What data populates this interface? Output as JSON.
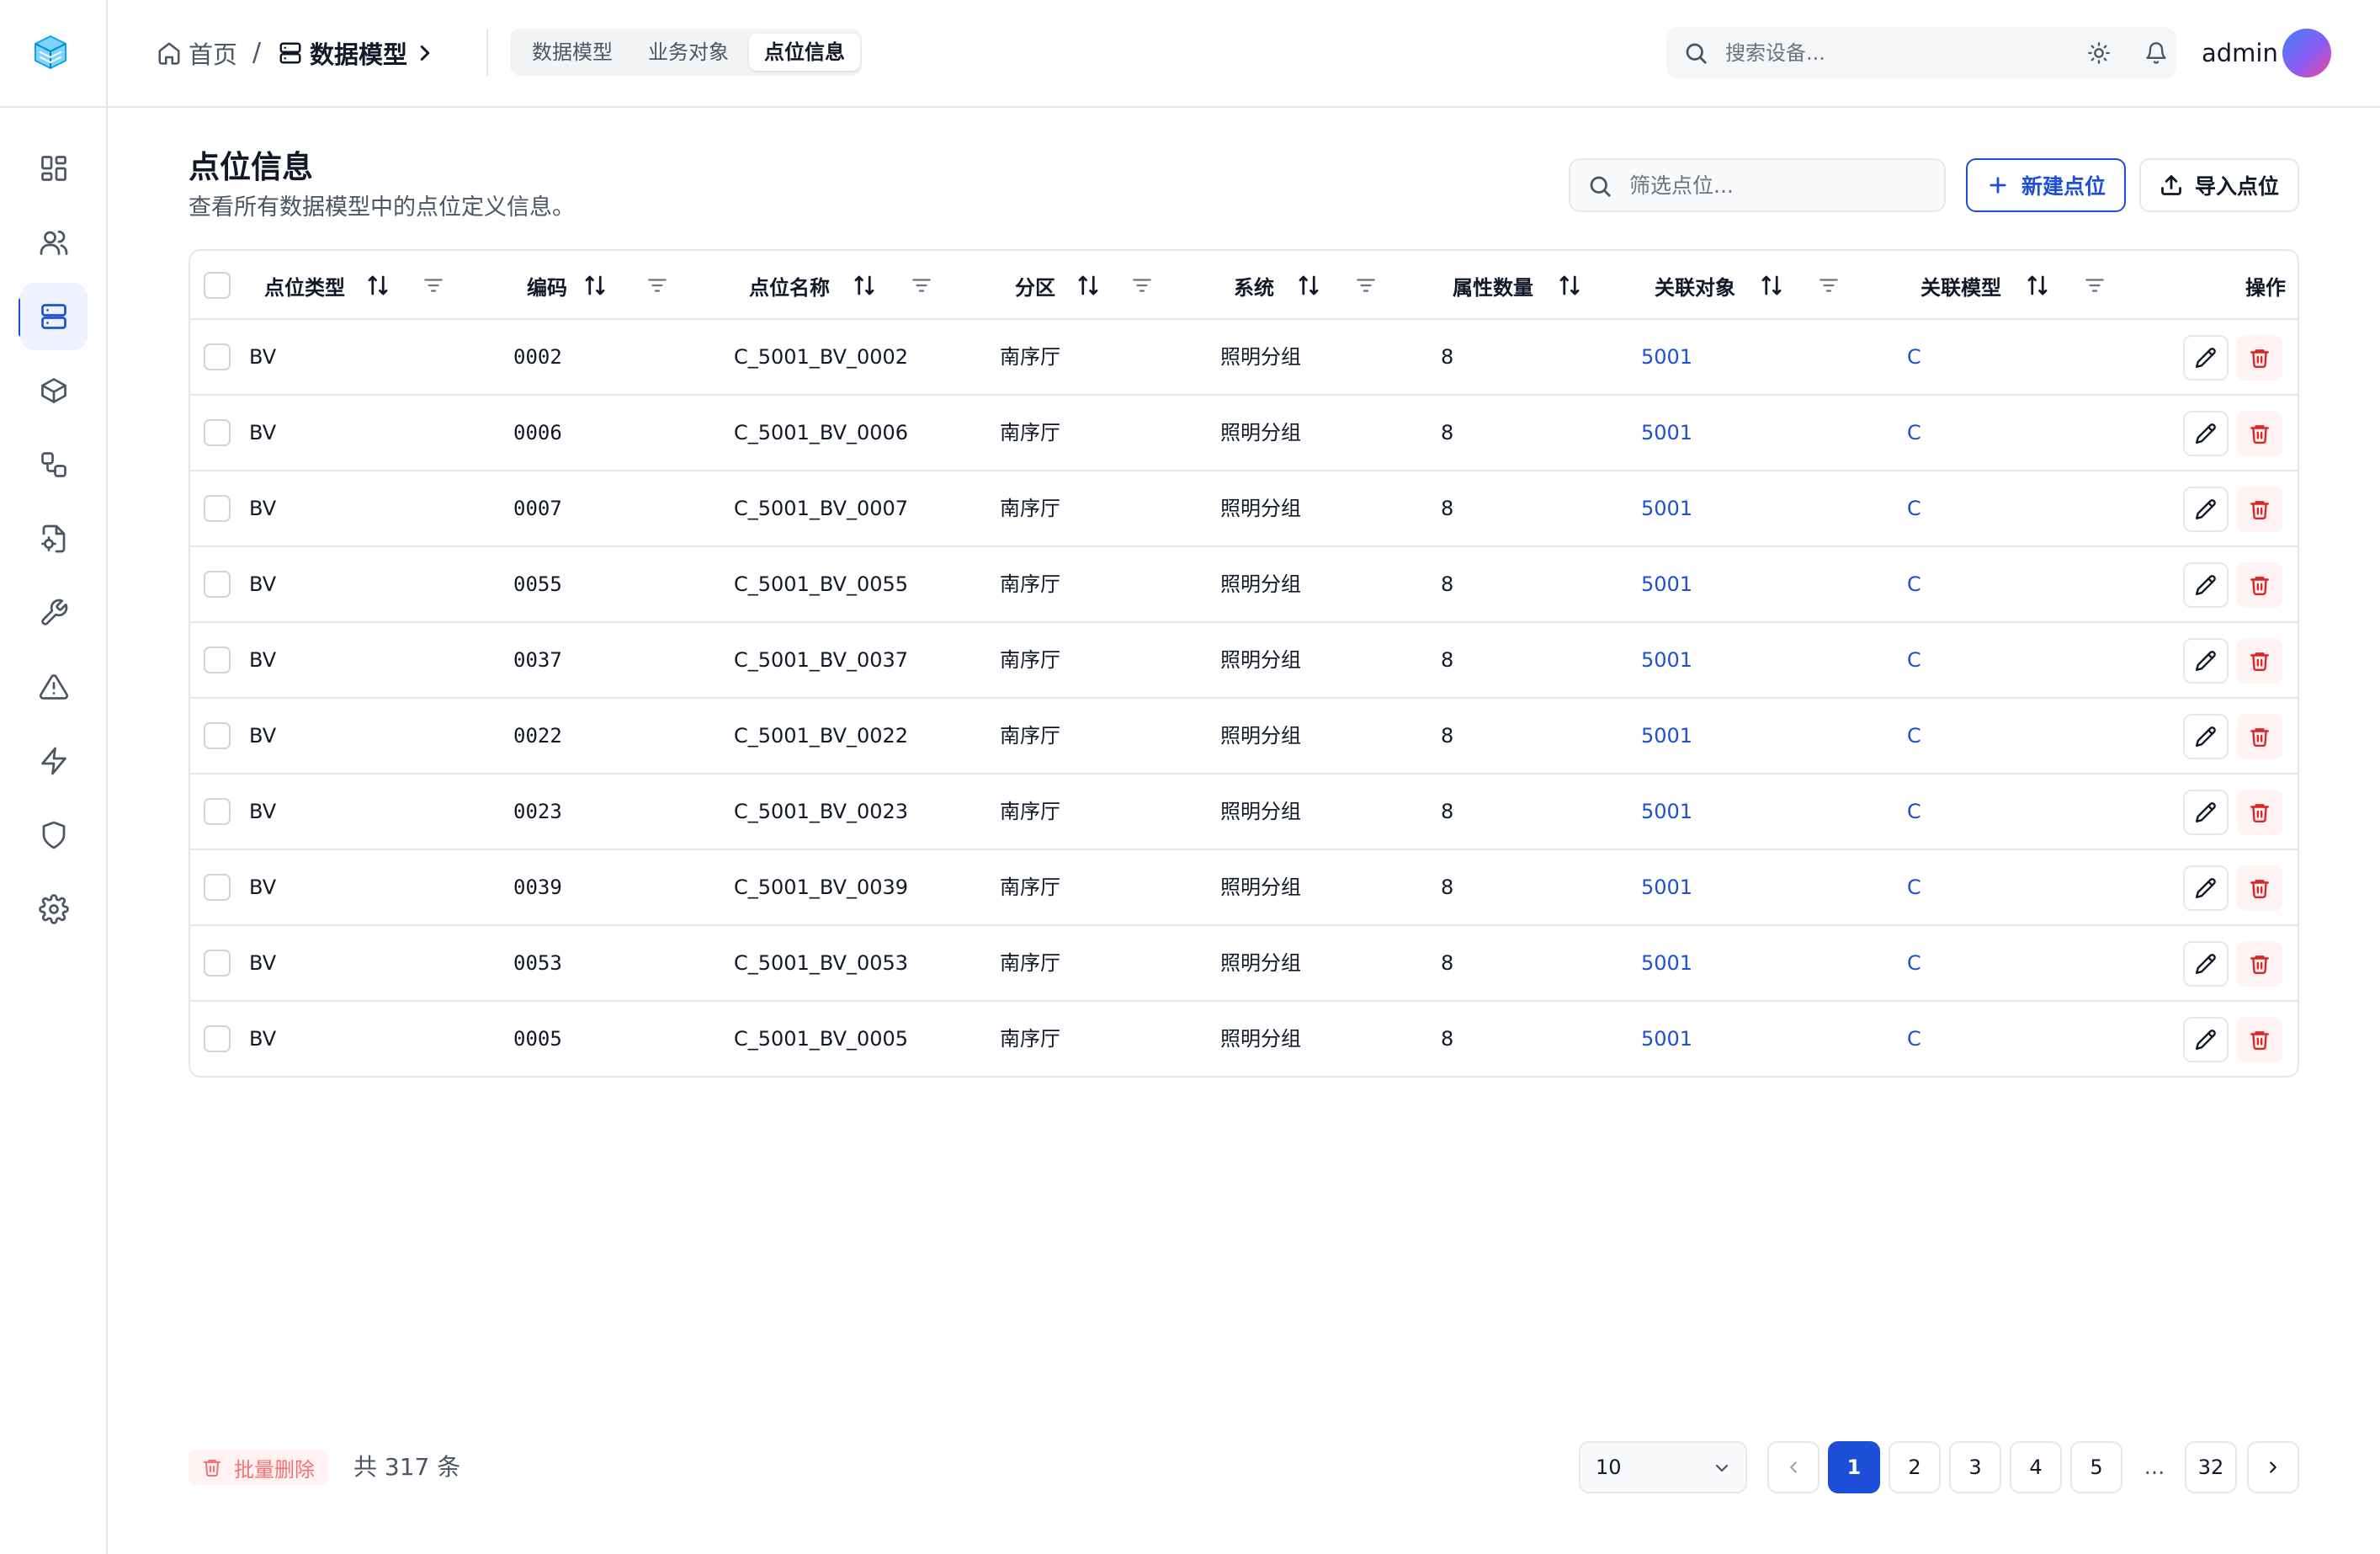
{
  "sidebar": {
    "logo": "cube-logo-icon",
    "items": [
      {
        "icon": "dashboard-icon",
        "active": false
      },
      {
        "icon": "users-icon",
        "active": false
      },
      {
        "icon": "database-icon",
        "active": true
      },
      {
        "icon": "cube-icon",
        "active": false
      },
      {
        "icon": "workflow-icon",
        "active": false
      },
      {
        "icon": "file-settings-icon",
        "active": false
      },
      {
        "icon": "wrench-icon",
        "active": false
      },
      {
        "icon": "alert-triangle-icon",
        "active": false
      },
      {
        "icon": "lightning-icon",
        "active": false
      },
      {
        "icon": "shield-icon",
        "active": false
      },
      {
        "icon": "gear-icon",
        "active": false
      }
    ]
  },
  "header": {
    "breadcrumb": {
      "home": "首页",
      "separator": "/",
      "current": "数据模型"
    },
    "tabs": [
      {
        "label": "数据模型",
        "active": false
      },
      {
        "label": "业务对象",
        "active": false
      },
      {
        "label": "点位信息",
        "active": true
      }
    ],
    "search": {
      "placeholder": "搜索设备..."
    },
    "username": "admin"
  },
  "page": {
    "title": "点位信息",
    "subtitle": "查看所有数据模型中的点位定义信息。",
    "filter_placeholder": "筛选点位...",
    "new_button": "新建点位",
    "import_button": "导入点位"
  },
  "table": {
    "columns": [
      "点位类型",
      "编码",
      "点位名称",
      "分区",
      "系统",
      "属性数量",
      "关联对象",
      "关联模型",
      "操作"
    ],
    "rows": [
      {
        "type": "BV",
        "code": "0002",
        "name": "C_5001_BV_0002",
        "zone": "南序厅",
        "system": "照明分组",
        "attr_count": "8",
        "object": "5001",
        "model": "C"
      },
      {
        "type": "BV",
        "code": "0006",
        "name": "C_5001_BV_0006",
        "zone": "南序厅",
        "system": "照明分组",
        "attr_count": "8",
        "object": "5001",
        "model": "C"
      },
      {
        "type": "BV",
        "code": "0007",
        "name": "C_5001_BV_0007",
        "zone": "南序厅",
        "system": "照明分组",
        "attr_count": "8",
        "object": "5001",
        "model": "C"
      },
      {
        "type": "BV",
        "code": "0055",
        "name": "C_5001_BV_0055",
        "zone": "南序厅",
        "system": "照明分组",
        "attr_count": "8",
        "object": "5001",
        "model": "C"
      },
      {
        "type": "BV",
        "code": "0037",
        "name": "C_5001_BV_0037",
        "zone": "南序厅",
        "system": "照明分组",
        "attr_count": "8",
        "object": "5001",
        "model": "C"
      },
      {
        "type": "BV",
        "code": "0022",
        "name": "C_5001_BV_0022",
        "zone": "南序厅",
        "system": "照明分组",
        "attr_count": "8",
        "object": "5001",
        "model": "C"
      },
      {
        "type": "BV",
        "code": "0023",
        "name": "C_5001_BV_0023",
        "zone": "南序厅",
        "system": "照明分组",
        "attr_count": "8",
        "object": "5001",
        "model": "C"
      },
      {
        "type": "BV",
        "code": "0039",
        "name": "C_5001_BV_0039",
        "zone": "南序厅",
        "system": "照明分组",
        "attr_count": "8",
        "object": "5001",
        "model": "C"
      },
      {
        "type": "BV",
        "code": "0053",
        "name": "C_5001_BV_0053",
        "zone": "南序厅",
        "system": "照明分组",
        "attr_count": "8",
        "object": "5001",
        "model": "C"
      },
      {
        "type": "BV",
        "code": "0005",
        "name": "C_5001_BV_0005",
        "zone": "南序厅",
        "system": "照明分组",
        "attr_count": "8",
        "object": "5001",
        "model": "C"
      }
    ]
  },
  "footer": {
    "bulk_delete": "批量删除",
    "total": "共 317 条",
    "page_size": "10",
    "pages": [
      "1",
      "2",
      "3",
      "4",
      "5"
    ],
    "ellipsis": "...",
    "last_page": "32",
    "current_page": "1"
  },
  "colors": {
    "accent": "#1d4ed8",
    "danger": "#dc2626",
    "border": "#e5e7eb"
  }
}
